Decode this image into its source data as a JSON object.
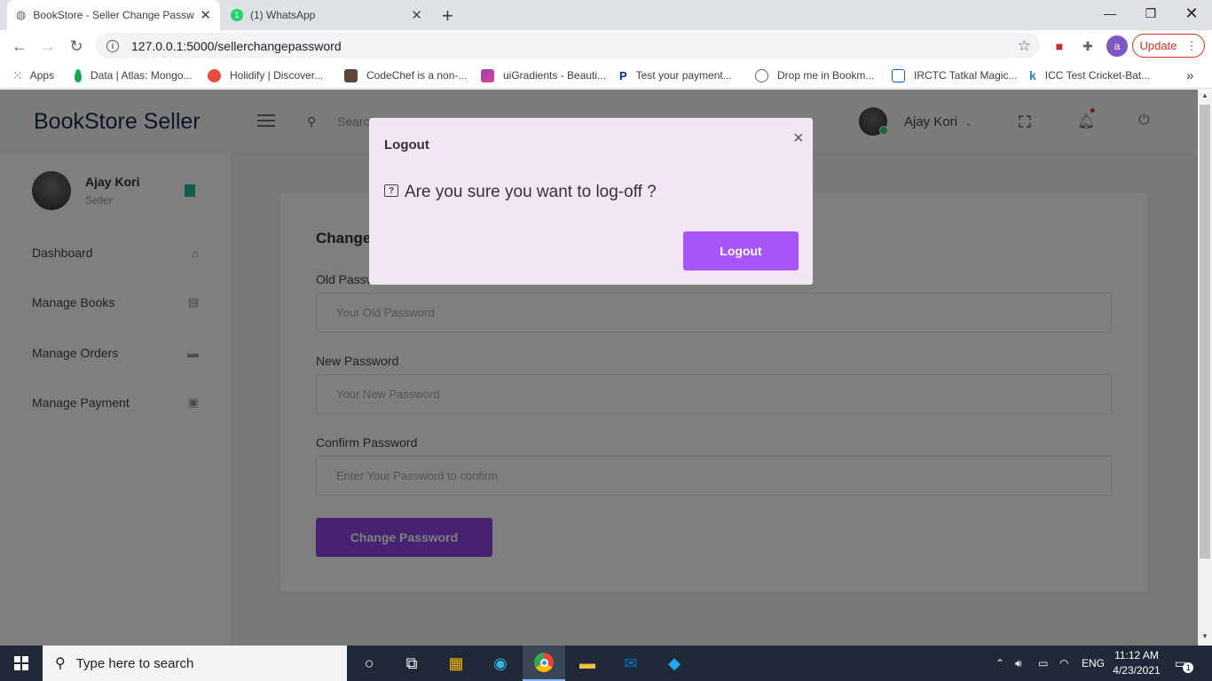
{
  "browser": {
    "tabs": [
      {
        "title": "BookStore - Seller Change Passw",
        "active": true
      },
      {
        "title": "(1) WhatsApp",
        "active": false
      }
    ],
    "new_tab": "+",
    "url": "127.0.0.1:5000/sellerchangepassword",
    "profile_letter": "a",
    "update_label": "Update",
    "bookmarks": [
      {
        "label": "Apps",
        "icon": "apps-grid-icon",
        "color": "#e94235"
      },
      {
        "label": "Data | Atlas: Mongo...",
        "icon": "mongodb-leaf-icon",
        "color": "#13aa52"
      },
      {
        "label": "Holidify | Discover...",
        "icon": "holidify-icon",
        "color": "#e84c3d"
      },
      {
        "label": "CodeChef is a non-...",
        "icon": "codechef-icon",
        "color": "#5b4638"
      },
      {
        "label": "uiGradients - Beauti...",
        "icon": "uigradients-icon",
        "color": "#8e44ad"
      },
      {
        "label": "Test your payment...",
        "icon": "paypal-icon",
        "color": "#003087"
      },
      {
        "label": "Drop me in Bookm...",
        "icon": "globe-icon",
        "color": "#5f6368"
      },
      {
        "label": "IRCTC Tatkal Magic...",
        "icon": "irctc-icon",
        "color": "#1a5fb4"
      },
      {
        "label": "ICC Test Cricket-Bat...",
        "icon": "icc-k-icon",
        "color": "#1e88e5"
      }
    ],
    "more_bookmarks": "»"
  },
  "app": {
    "brand": "BookStore Seller",
    "search_placeholder": "Search",
    "user_name": "Ajay Kori",
    "sidebar": {
      "user_name": "Ajay Kori",
      "user_role": "Seller",
      "items": [
        {
          "label": "Dashboard",
          "icon": "home-icon"
        },
        {
          "label": "Manage Books",
          "icon": "books-icon"
        },
        {
          "label": "Manage Orders",
          "icon": "truck-icon"
        },
        {
          "label": "Manage Payment",
          "icon": "payment-icon"
        }
      ]
    },
    "form": {
      "title": "Change Password",
      "old_label": "Old Password",
      "old_placeholder": "Your Old Password",
      "new_label": "New Password",
      "new_placeholder": "Your New Password",
      "confirm_label": "Confirm Password",
      "confirm_placeholder": "Enter Your Password to confirm",
      "submit_label": "Change Password"
    }
  },
  "modal": {
    "title": "Logout",
    "close": "×",
    "message": "Are you sure you want to log-off ?",
    "button_label": "Logout"
  },
  "taskbar": {
    "search_placeholder": "Type here to search",
    "language": "ENG",
    "time": "11:12 AM",
    "date": "4/23/2021",
    "notification_count": "1"
  },
  "colors": {
    "accent": "#8e44e0",
    "modal_bg": "#f3e5f5",
    "modal_button": "#a855f7",
    "brand_text": "#1b2a4e"
  }
}
